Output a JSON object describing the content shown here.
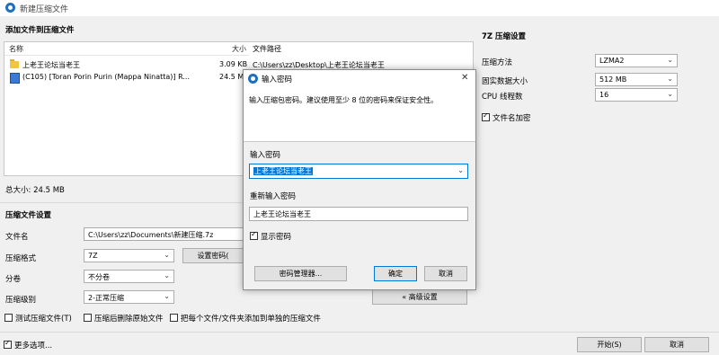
{
  "window": {
    "title": "新建压缩文件"
  },
  "files_section": {
    "title": "添加文件到压缩文件",
    "columns": {
      "name": "名称",
      "size": "大小",
      "path": "文件路径"
    },
    "rows": [
      {
        "name": "上老王论坛当老王",
        "size": "3.09 KB",
        "path": "C:\\Users\\zz\\Desktop\\上老王论坛当老王"
      },
      {
        "name": "(C105) [Toran Porin Purin (Mappa Ninatta)] R...",
        "size": "24.5 M",
        "path": ""
      }
    ],
    "total_size": "总大小: 24.5 MB"
  },
  "archive_settings": {
    "title": "压缩文件设置",
    "filename_label": "文件名",
    "filename_value": "C:\\Users\\zz\\Documents\\新建压缩.7z",
    "format_label": "压缩格式",
    "format_value": "7Z",
    "set_password_button": "设置密码(",
    "split_label": "分卷",
    "split_value": "不分卷",
    "level_label": "压缩级别",
    "level_value": "2-正常压缩",
    "advanced_button": "« 高级设置",
    "check_test": "测试压缩文件(T)",
    "check_delete": "压缩后删除原始文件",
    "check_separate": "把每个文件/文件夹添加到单独的压缩文件"
  },
  "seven_z": {
    "title": "7Z 压缩设置",
    "method_label": "压缩方法",
    "method_value": "LZMA2",
    "dict_label": "固实数据大小",
    "dict_value": "512 MB",
    "threads_label": "CPU 线程数",
    "threads_value": "16",
    "encrypt_names_label": "文件名加密",
    "encrypt_names_checked": true
  },
  "footer": {
    "more_options": "更多选项...",
    "more_options_checked": true,
    "start_button": "开始(S)",
    "cancel_button": "取消"
  },
  "password_dialog": {
    "title": "输入密码",
    "hint": "输入压缩包密码。建议使用至少 8 位的密码来保证安全性。",
    "enter_label": "输入密码",
    "enter_value": "上老王论坛当老王",
    "reenter_label": "重新输入密码",
    "reenter_value": "上老王论坛当老王",
    "show_password_label": "显示密码",
    "show_password_checked": true,
    "manager_button": "密码管理器...",
    "ok_button": "确定",
    "cancel_button": "取消",
    "close_glyph": "✕"
  },
  "colors": {
    "accent": "#0078d7",
    "selection": "#0078d7"
  }
}
